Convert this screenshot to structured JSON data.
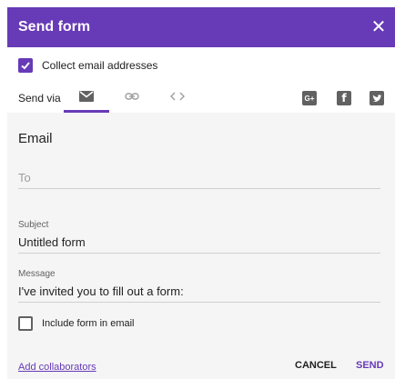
{
  "dialog": {
    "title": "Send form",
    "close_icon": "close-icon"
  },
  "collect_email": {
    "label": "Collect email addresses",
    "checked": true
  },
  "send_via": {
    "label": "Send via",
    "tabs": [
      {
        "icon": "email-icon",
        "selected": true
      },
      {
        "icon": "link-icon",
        "selected": false
      },
      {
        "icon": "embed-icon",
        "selected": false
      }
    ],
    "social": [
      {
        "icon": "google-plus-icon",
        "text": "G+"
      },
      {
        "icon": "facebook-icon",
        "text": "f"
      },
      {
        "icon": "twitter-icon"
      }
    ]
  },
  "email_panel": {
    "title": "Email",
    "to_placeholder": "To",
    "subject_label": "Subject",
    "subject_value": "Untitled form",
    "message_label": "Message",
    "message_value": "I've invited you to fill out a form:",
    "include_label": "Include form in email",
    "include_checked": false
  },
  "footer": {
    "add_collaborators": "Add collaborators",
    "cancel": "CANCEL",
    "send": "SEND"
  },
  "colors": {
    "accent": "#673ab7",
    "panel_bg": "#f5f5f5"
  }
}
